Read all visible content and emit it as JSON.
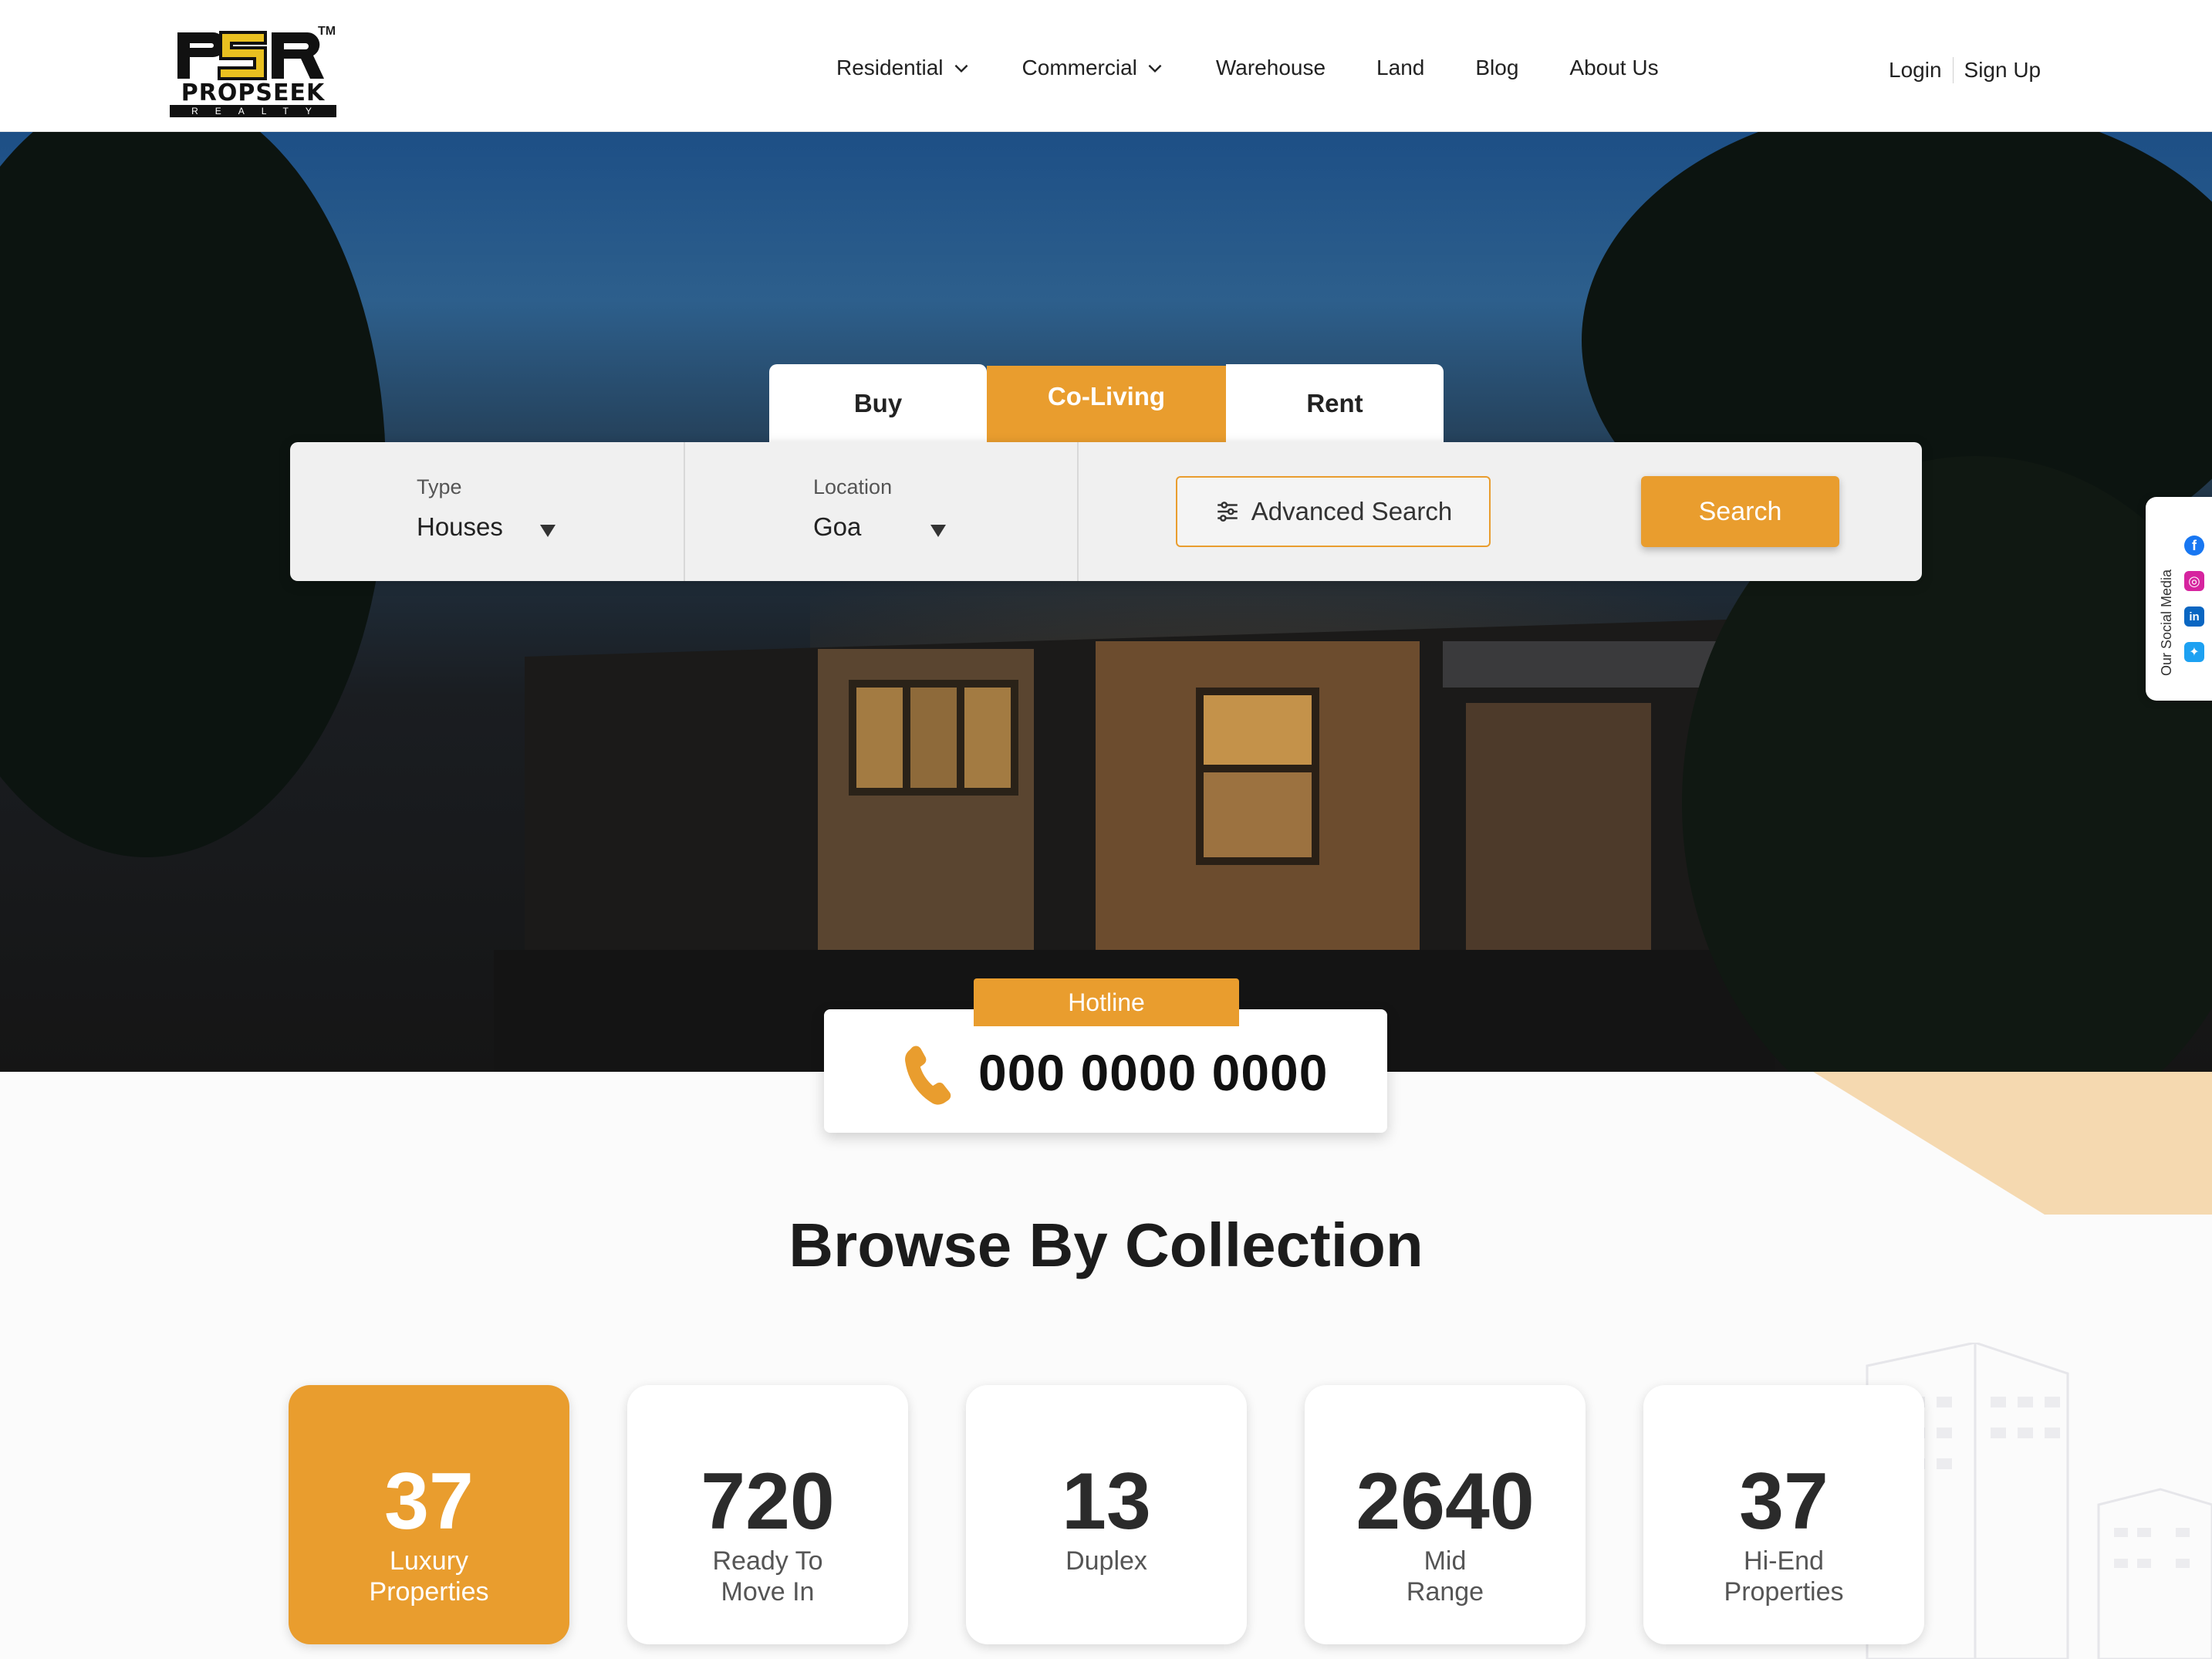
{
  "logo": {
    "mark": "PSR",
    "tm": "TM",
    "brand": "PROPSEEK",
    "sub": "REALTY"
  },
  "nav": [
    {
      "label": "Residential",
      "dropdown": true
    },
    {
      "label": "Commercial",
      "dropdown": true
    },
    {
      "label": "Warehouse",
      "dropdown": false
    },
    {
      "label": "Land",
      "dropdown": false
    },
    {
      "label": "Blog",
      "dropdown": false
    },
    {
      "label": "About Us",
      "dropdown": false
    }
  ],
  "auth": {
    "login": "Login",
    "signup": "Sign Up"
  },
  "tabs": [
    {
      "label": "Buy",
      "active": false
    },
    {
      "label": "Co-Living",
      "active": true
    },
    {
      "label": "Rent",
      "active": false
    }
  ],
  "search": {
    "type_label": "Type",
    "type_value": "Houses",
    "location_label": "Location",
    "location_value": "Goa",
    "advanced_label": "Advanced Search",
    "search_label": "Search"
  },
  "social": {
    "label": "Our Social Media",
    "icons": [
      "facebook-icon",
      "instagram-icon",
      "linkedin-icon",
      "twitter-icon"
    ]
  },
  "hotline": {
    "tag": "Hotline",
    "number": "000 0000 0000"
  },
  "section_title": "Browse By Collection",
  "collections": [
    {
      "count": "37",
      "line1": "Luxury",
      "line2": "Properties",
      "active": true
    },
    {
      "count": "720",
      "line1": "Ready To",
      "line2": "Move In",
      "active": false
    },
    {
      "count": "13",
      "line1": "Duplex",
      "line2": "",
      "active": false
    },
    {
      "count": "2640",
      "line1": "Mid",
      "line2": "Range",
      "active": false
    },
    {
      "count": "37",
      "line1": "Hi-End",
      "line2": "Properties",
      "active": false
    }
  ],
  "colors": {
    "accent": "#e99d2e",
    "text": "#222222",
    "wedge": "#f5d9b0"
  }
}
